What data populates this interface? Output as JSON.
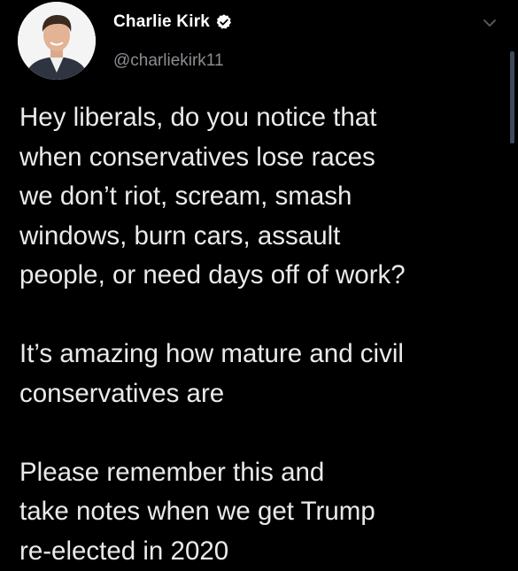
{
  "author": {
    "name": "Charlie Kirk",
    "handle": "@charliekirk11",
    "verified": true,
    "avatar_icon": "profile-photo"
  },
  "menu_icon": "chevron-down-icon",
  "tweet": {
    "paragraphs": [
      {
        "lines": [
          "Hey liberals, do you notice that",
          "when conservatives lose races",
          "we don’t riot, scream, smash",
          "windows, burn cars, assault",
          "people, or need days off of work?"
        ]
      },
      {
        "lines": [
          "It’s amazing how mature and civil",
          "conservatives are"
        ]
      },
      {
        "lines": [
          "Please remember this and",
          "take notes when we get Trump",
          "re-elected in 2020"
        ]
      }
    ]
  },
  "colors": {
    "background": "#000000",
    "text": "#e9eaeb",
    "handle": "#8b8e92",
    "verified_badge": "#ffffff"
  }
}
